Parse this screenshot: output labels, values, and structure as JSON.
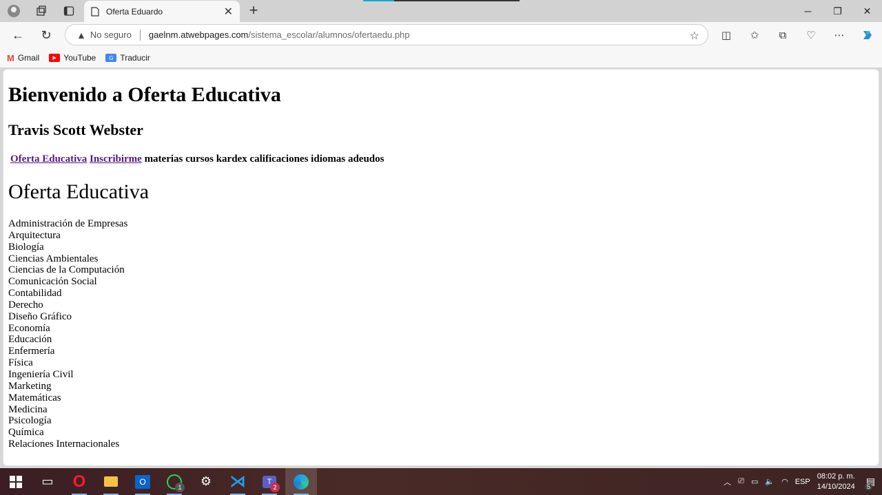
{
  "browser": {
    "tab_title": "Oferta Eduardo",
    "address": {
      "security_label": "No seguro",
      "host": "gaelnm.atwebpages.com",
      "path": "/sistema_escolar/alumnos/ofertaedu.php"
    },
    "bookmarks": [
      {
        "label": "Gmail",
        "color": "#ea4335"
      },
      {
        "label": "YouTube",
        "color": "#ff0000"
      },
      {
        "label": "Traducir",
        "color": "#4285f4"
      }
    ]
  },
  "page": {
    "welcome_heading": "Bienvenido a Oferta Educativa",
    "user_name": "Travis Scott Webster",
    "menu": {
      "link_oferta": "Oferta Educativa",
      "link_inscribirme": "Inscribirme",
      "static_items": "materias cursos kardex calificaciones idiomas adeudos"
    },
    "section_heading": "Oferta Educativa",
    "programs": [
      "Administración de Empresas",
      "Arquitectura",
      "Biología",
      "Ciencias Ambientales",
      "Ciencias de la Computación",
      "Comunicación Social",
      "Contabilidad",
      "Derecho",
      "Diseño Gráfico",
      "Economía",
      "Educación",
      "Enfermería",
      "Física",
      "Ingeniería Civil",
      "Marketing",
      "Matemáticas",
      "Medicina",
      "Psicología",
      "Química",
      "Relaciones Internacionales"
    ],
    "link_color": "#551a8b"
  },
  "taskbar": {
    "language": "ESP",
    "time": "08:02 p. m.",
    "date": "14/10/2024",
    "whatsapp_badge": "1",
    "teams_badge": "2",
    "notifications_badge": "5"
  }
}
